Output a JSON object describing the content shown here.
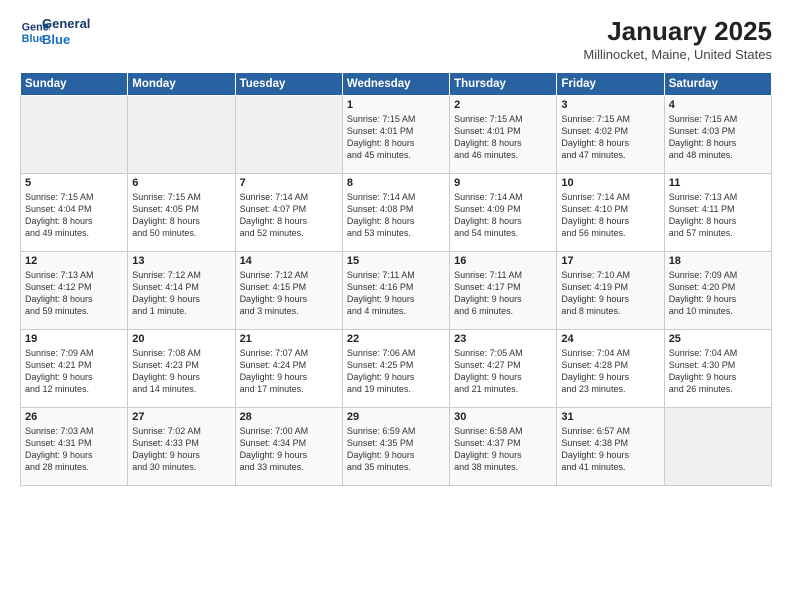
{
  "header": {
    "logo_line1": "General",
    "logo_line2": "Blue",
    "title": "January 2025",
    "subtitle": "Millinocket, Maine, United States"
  },
  "weekdays": [
    "Sunday",
    "Monday",
    "Tuesday",
    "Wednesday",
    "Thursday",
    "Friday",
    "Saturday"
  ],
  "weeks": [
    [
      {
        "day": "",
        "info": ""
      },
      {
        "day": "",
        "info": ""
      },
      {
        "day": "",
        "info": ""
      },
      {
        "day": "1",
        "info": "Sunrise: 7:15 AM\nSunset: 4:01 PM\nDaylight: 8 hours\nand 45 minutes."
      },
      {
        "day": "2",
        "info": "Sunrise: 7:15 AM\nSunset: 4:01 PM\nDaylight: 8 hours\nand 46 minutes."
      },
      {
        "day": "3",
        "info": "Sunrise: 7:15 AM\nSunset: 4:02 PM\nDaylight: 8 hours\nand 47 minutes."
      },
      {
        "day": "4",
        "info": "Sunrise: 7:15 AM\nSunset: 4:03 PM\nDaylight: 8 hours\nand 48 minutes."
      }
    ],
    [
      {
        "day": "5",
        "info": "Sunrise: 7:15 AM\nSunset: 4:04 PM\nDaylight: 8 hours\nand 49 minutes."
      },
      {
        "day": "6",
        "info": "Sunrise: 7:15 AM\nSunset: 4:05 PM\nDaylight: 8 hours\nand 50 minutes."
      },
      {
        "day": "7",
        "info": "Sunrise: 7:14 AM\nSunset: 4:07 PM\nDaylight: 8 hours\nand 52 minutes."
      },
      {
        "day": "8",
        "info": "Sunrise: 7:14 AM\nSunset: 4:08 PM\nDaylight: 8 hours\nand 53 minutes."
      },
      {
        "day": "9",
        "info": "Sunrise: 7:14 AM\nSunset: 4:09 PM\nDaylight: 8 hours\nand 54 minutes."
      },
      {
        "day": "10",
        "info": "Sunrise: 7:14 AM\nSunset: 4:10 PM\nDaylight: 8 hours\nand 56 minutes."
      },
      {
        "day": "11",
        "info": "Sunrise: 7:13 AM\nSunset: 4:11 PM\nDaylight: 8 hours\nand 57 minutes."
      }
    ],
    [
      {
        "day": "12",
        "info": "Sunrise: 7:13 AM\nSunset: 4:12 PM\nDaylight: 8 hours\nand 59 minutes."
      },
      {
        "day": "13",
        "info": "Sunrise: 7:12 AM\nSunset: 4:14 PM\nDaylight: 9 hours\nand 1 minute."
      },
      {
        "day": "14",
        "info": "Sunrise: 7:12 AM\nSunset: 4:15 PM\nDaylight: 9 hours\nand 3 minutes."
      },
      {
        "day": "15",
        "info": "Sunrise: 7:11 AM\nSunset: 4:16 PM\nDaylight: 9 hours\nand 4 minutes."
      },
      {
        "day": "16",
        "info": "Sunrise: 7:11 AM\nSunset: 4:17 PM\nDaylight: 9 hours\nand 6 minutes."
      },
      {
        "day": "17",
        "info": "Sunrise: 7:10 AM\nSunset: 4:19 PM\nDaylight: 9 hours\nand 8 minutes."
      },
      {
        "day": "18",
        "info": "Sunrise: 7:09 AM\nSunset: 4:20 PM\nDaylight: 9 hours\nand 10 minutes."
      }
    ],
    [
      {
        "day": "19",
        "info": "Sunrise: 7:09 AM\nSunset: 4:21 PM\nDaylight: 9 hours\nand 12 minutes."
      },
      {
        "day": "20",
        "info": "Sunrise: 7:08 AM\nSunset: 4:23 PM\nDaylight: 9 hours\nand 14 minutes."
      },
      {
        "day": "21",
        "info": "Sunrise: 7:07 AM\nSunset: 4:24 PM\nDaylight: 9 hours\nand 17 minutes."
      },
      {
        "day": "22",
        "info": "Sunrise: 7:06 AM\nSunset: 4:25 PM\nDaylight: 9 hours\nand 19 minutes."
      },
      {
        "day": "23",
        "info": "Sunrise: 7:05 AM\nSunset: 4:27 PM\nDaylight: 9 hours\nand 21 minutes."
      },
      {
        "day": "24",
        "info": "Sunrise: 7:04 AM\nSunset: 4:28 PM\nDaylight: 9 hours\nand 23 minutes."
      },
      {
        "day": "25",
        "info": "Sunrise: 7:04 AM\nSunset: 4:30 PM\nDaylight: 9 hours\nand 26 minutes."
      }
    ],
    [
      {
        "day": "26",
        "info": "Sunrise: 7:03 AM\nSunset: 4:31 PM\nDaylight: 9 hours\nand 28 minutes."
      },
      {
        "day": "27",
        "info": "Sunrise: 7:02 AM\nSunset: 4:33 PM\nDaylight: 9 hours\nand 30 minutes."
      },
      {
        "day": "28",
        "info": "Sunrise: 7:00 AM\nSunset: 4:34 PM\nDaylight: 9 hours\nand 33 minutes."
      },
      {
        "day": "29",
        "info": "Sunrise: 6:59 AM\nSunset: 4:35 PM\nDaylight: 9 hours\nand 35 minutes."
      },
      {
        "day": "30",
        "info": "Sunrise: 6:58 AM\nSunset: 4:37 PM\nDaylight: 9 hours\nand 38 minutes."
      },
      {
        "day": "31",
        "info": "Sunrise: 6:57 AM\nSunset: 4:38 PM\nDaylight: 9 hours\nand 41 minutes."
      },
      {
        "day": "",
        "info": ""
      }
    ]
  ]
}
